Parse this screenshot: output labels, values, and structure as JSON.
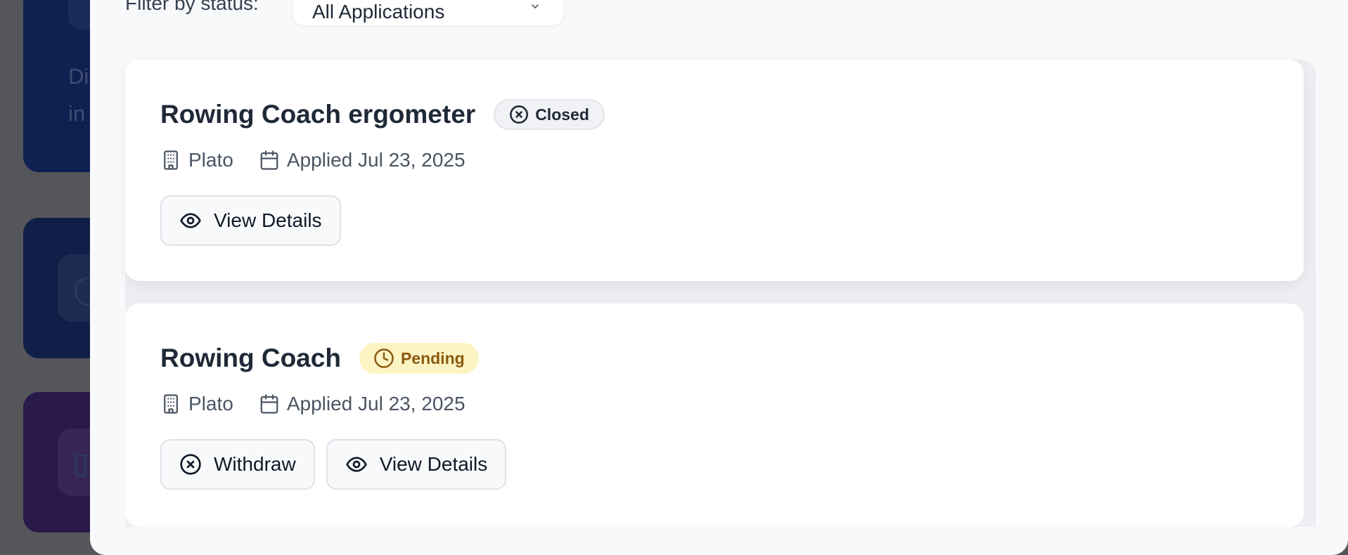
{
  "background": {
    "partial_text": [
      "Di",
      "in"
    ]
  },
  "filter": {
    "label": "Filter by status:",
    "selected": "All Applications"
  },
  "applications": [
    {
      "title": "Rowing Coach ergometer",
      "status": "Closed",
      "status_icon": "x-circle-icon",
      "company": "Plato",
      "applied": "Applied Jul 23, 2025",
      "actions": [
        "View Details"
      ]
    },
    {
      "title": "Rowing Coach",
      "status": "Pending",
      "status_icon": "clock-icon",
      "company": "Plato",
      "applied": "Applied Jul 23, 2025",
      "actions": [
        "Withdraw",
        "View Details"
      ]
    }
  ],
  "colors": {
    "pending_bg": "#fdf4c4",
    "pending_text": "#8a5a10",
    "closed_bg": "#f1f2f5",
    "backdrop": "#555659"
  }
}
